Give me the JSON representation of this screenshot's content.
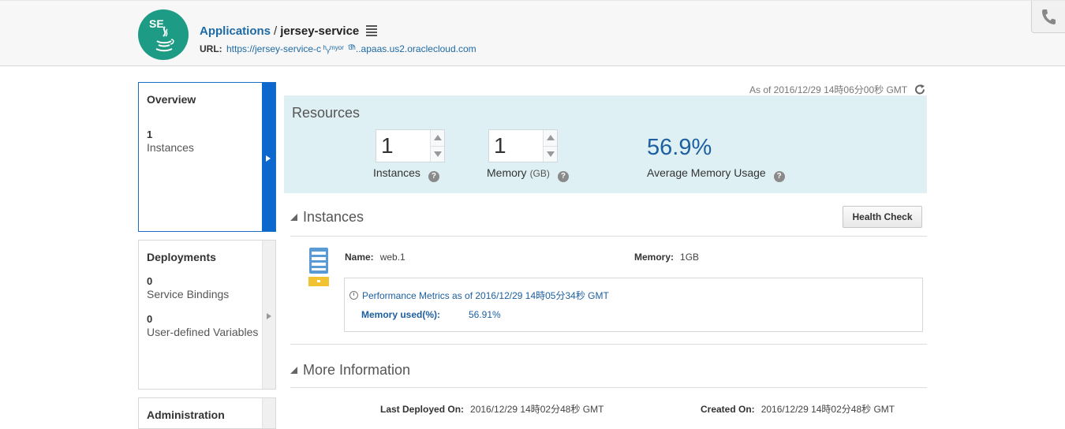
{
  "header": {
    "avatar_abbr": "SE",
    "breadcrumb_parent": "Applications",
    "breadcrumb_separator": "/",
    "service_name": "jersey-service",
    "url_label": "URL:",
    "url_value": "https://jersey-service-c ʰᵧᵐʸᵒʳ  ͡ᵈʰ..apaas.us2.oraclecloud.com"
  },
  "sidebar": {
    "overview": {
      "title": "Overview",
      "count": "1",
      "label": "Instances"
    },
    "deployments": {
      "title": "Deployments",
      "items": [
        {
          "count": "0",
          "label": "Service Bindings"
        },
        {
          "count": "0",
          "label": "User-defined Variables"
        }
      ]
    },
    "administration": {
      "title": "Administration"
    }
  },
  "main": {
    "as_of": "As of 2016/12/29 14時06分00秒 GMT",
    "resources": {
      "title": "Resources",
      "instances_value": "1",
      "instances_label": "Instances",
      "memory_value": "1",
      "memory_label": "Memory",
      "memory_unit": "(GB)",
      "avg_memory_value": "56.9%",
      "avg_memory_label": "Average Memory Usage",
      "help_glyph": "?"
    },
    "instances_section": {
      "title": "Instances",
      "health_check_label": "Health Check",
      "instance": {
        "name_label": "Name:",
        "name_value": "web.1",
        "memory_label": "Memory:",
        "memory_value": "1GB",
        "perf_title": "Performance Metrics as of 2016/12/29 14時05分34秒 GMT",
        "memory_used_label": "Memory used(%):",
        "memory_used_value": "56.91%"
      }
    },
    "more_info": {
      "title": "More Information",
      "last_deployed_label": "Last Deployed On:",
      "last_deployed_value": "2016/12/29 14時02分48秒 GMT",
      "created_label": "Created On:",
      "created_value": "2016/12/29 14時02分48秒 GMT"
    }
  },
  "colors": {
    "accent": "#0c68cf",
    "link": "#1d6aa5",
    "avatar": "#1e9b84",
    "resources_bg": "#dff0f4"
  },
  "icons": [
    "java-icon",
    "menu-icon",
    "phone-icon",
    "refresh-icon",
    "help-icon",
    "server-icon",
    "clock-icon",
    "collapse-icon"
  ]
}
